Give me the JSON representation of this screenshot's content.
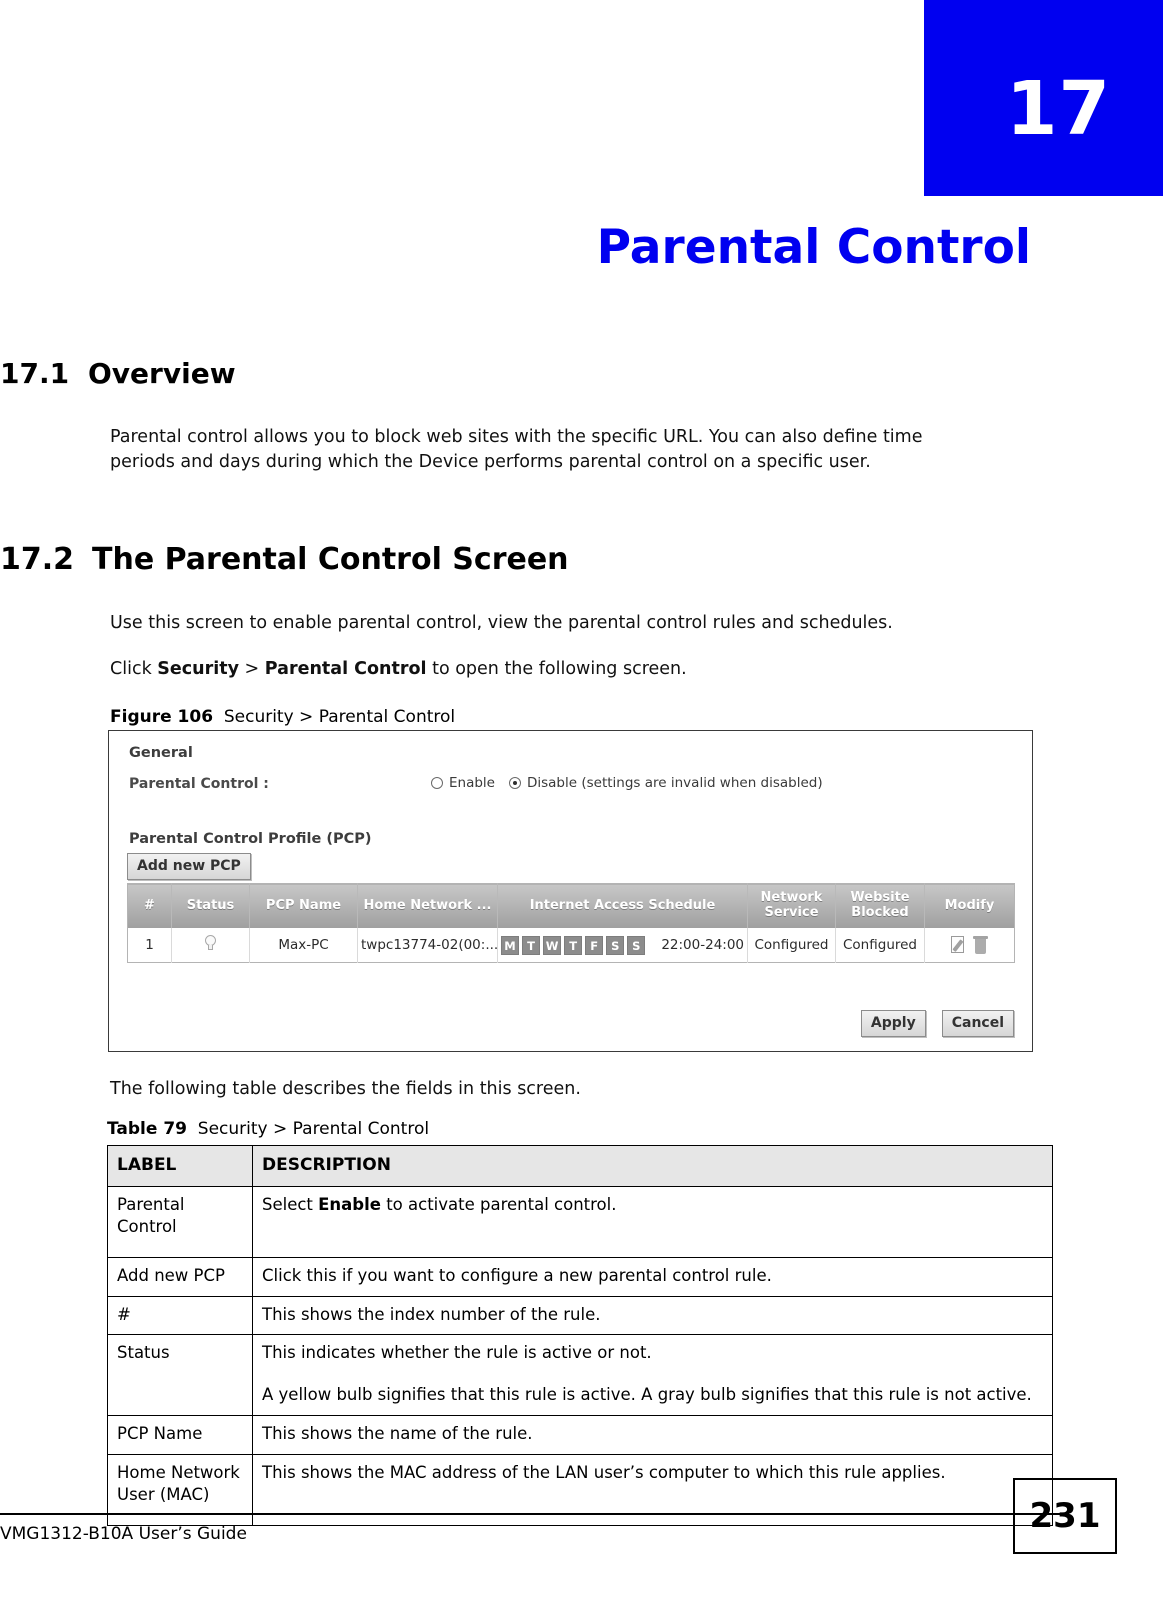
{
  "chapter": {
    "number": "17",
    "title": "Parental Control"
  },
  "sections": {
    "overview": {
      "number": "17.1",
      "heading": "Overview",
      "paragraph": "Parental control allows you to block web sites with the specific URL. You can also define time periods and days during which the Device performs parental control on a specific user."
    },
    "screen": {
      "number": "17.2",
      "heading": "The Parental Control Screen",
      "paragraph_use": "Use this screen to enable parental control, view the parental control rules and schedules.",
      "click_prefix": "Click ",
      "click_bold_1": "Security",
      "click_sep": " > ",
      "click_bold_2": "Parental Control",
      "click_suffix": " to open the following screen.",
      "following_table": "The following table describes the fields in this screen."
    }
  },
  "figure": {
    "caption_label": "Figure 106",
    "caption_text": "Security > Parental Control",
    "general_title": "General",
    "parental_control_label": "Parental Control :",
    "radio_enable_label": "Enable",
    "radio_disable_label": "Disable (settings are invalid when disabled)",
    "selected_radio": "Disable",
    "pcp_section_title": "Parental Control Profile (PCP)",
    "add_new_pcp_button": "Add new PCP",
    "table": {
      "headers": [
        "#",
        "Status",
        "PCP Name",
        "Home Network ...",
        "Internet Access Schedule",
        "Network Service",
        "Website Blocked",
        "Modify"
      ],
      "rows": [
        {
          "index": "1",
          "status_icon": "lightbulb-icon",
          "pcp_name": "Max-PC",
          "home_network_user": "twpc13774-02(00:...",
          "days": [
            "M",
            "T",
            "W",
            "T",
            "F",
            "S",
            "S"
          ],
          "time": "22:00-24:00",
          "network_service": "Configured",
          "website_blocked": "Configured",
          "modify_icons": [
            "edit-icon",
            "delete-icon"
          ]
        }
      ]
    },
    "apply_button": "Apply",
    "cancel_button": "Cancel"
  },
  "description_table": {
    "caption_label": "Table 79",
    "caption_text": "Security > Parental Control",
    "headers": [
      "LABEL",
      "DESCRIPTION"
    ],
    "rows": [
      {
        "label": "Parental Control",
        "desc_prefix": "Select ",
        "desc_bold": "Enable",
        "desc_suffix": " to activate parental control."
      },
      {
        "label": "Add new PCP",
        "description": "Click this if you want to configure a new parental control rule."
      },
      {
        "label": "#",
        "description": "This shows the index number of the rule."
      },
      {
        "label": "Status",
        "description": "This indicates whether the rule is active or not.",
        "description_2": "A yellow bulb signifies that this rule is active. A gray bulb signifies that this rule is not active."
      },
      {
        "label": "PCP Name",
        "description": "This shows the name of the rule."
      },
      {
        "label": "Home Network User (MAC)",
        "description": "This shows the MAC address of the LAN user’s computer to which this rule applies."
      }
    ]
  },
  "footer": {
    "guide_title": "VMG1312-B10A User’s Guide",
    "page_number": "231"
  },
  "colors": {
    "chapter_blue": "#0000f0",
    "table_header_gray": "#e6e6e6"
  }
}
